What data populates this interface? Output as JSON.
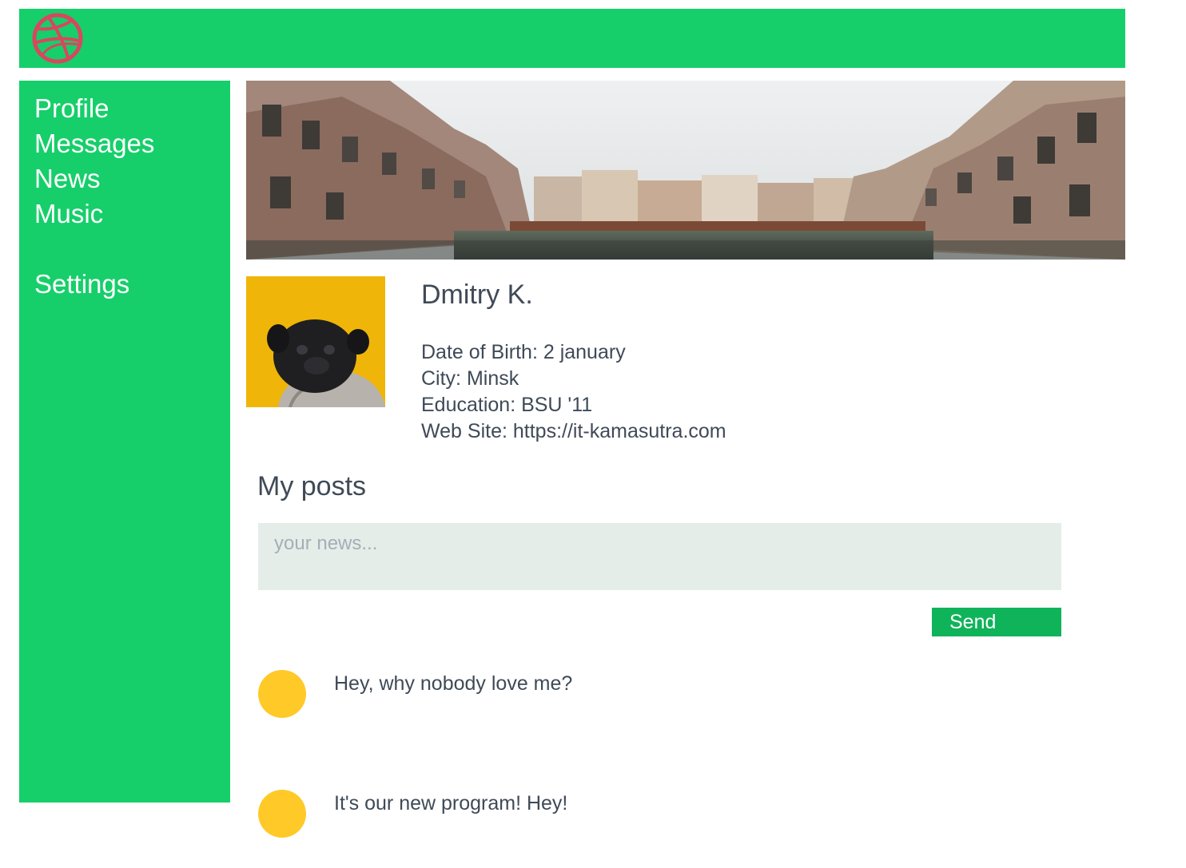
{
  "header": {
    "logo_icon": "dribbble-ball-icon",
    "logo_color": "#d9465f"
  },
  "sidebar": {
    "items": [
      {
        "label": "Profile"
      },
      {
        "label": "Messages"
      },
      {
        "label": "News"
      },
      {
        "label": "Music"
      },
      {
        "label": "Settings"
      }
    ]
  },
  "colors": {
    "primary_green": "#16cf6a",
    "button_green": "#0fb35a",
    "textarea_bg": "#e5ede9",
    "post_avatar": "#ffc928",
    "text": "#3f4a57"
  },
  "banner": {
    "image": "venice-canal-photo"
  },
  "profile": {
    "avatar_image": "pug-in-sweater-photo",
    "name": "Dmitry K.",
    "info": [
      "Date of Birth: 2 january",
      "City: Minsk",
      "Education: BSU '11",
      "Web Site: https://it-kamasutra.com"
    ]
  },
  "posts": {
    "title": "My posts",
    "new_post_placeholder": "your news...",
    "new_post_value": "",
    "send_label": "Send",
    "items": [
      {
        "text": "Hey, why nobody love me?"
      },
      {
        "text": "It's our new program! Hey!"
      }
    ]
  }
}
